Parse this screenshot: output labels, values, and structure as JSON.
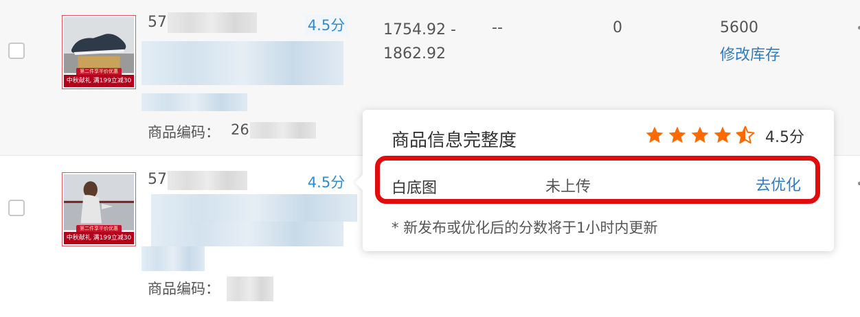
{
  "rows": [
    {
      "product_id_prefix": "57",
      "score_label": "4.5分",
      "code_label": "商品编码：",
      "code_prefix": "26",
      "promo_banner": "中秋献礼 满199立减30",
      "promo_top": "第二件享半价优惠",
      "price_range_line1": "1754.92 -",
      "price_range_line2": "1862.92",
      "col_dash": "--",
      "col_zero": "0",
      "stock": "5600",
      "stock_link": "修改库存"
    },
    {
      "product_id_prefix": "57",
      "score_label": "4.5分",
      "code_label": "商品编码：",
      "promo_banner": "中秋献礼 满199立减30",
      "promo_top": "第二件享半价优惠"
    }
  ],
  "popover": {
    "title": "商品信息完整度",
    "rating": 4.5,
    "score": "4.5分",
    "item_label": "白底图",
    "item_status": "未上传",
    "item_action": "去优化",
    "note": "* 新发布或优化后的分数将于1小时内更新"
  },
  "colors": {
    "link": "#2e7bc4",
    "star": "#ff6a00",
    "highlight": "#e30b0b",
    "promo": "#b3001b"
  },
  "icons": [
    "checkbox-icon",
    "star-icon",
    "half-star-icon"
  ]
}
